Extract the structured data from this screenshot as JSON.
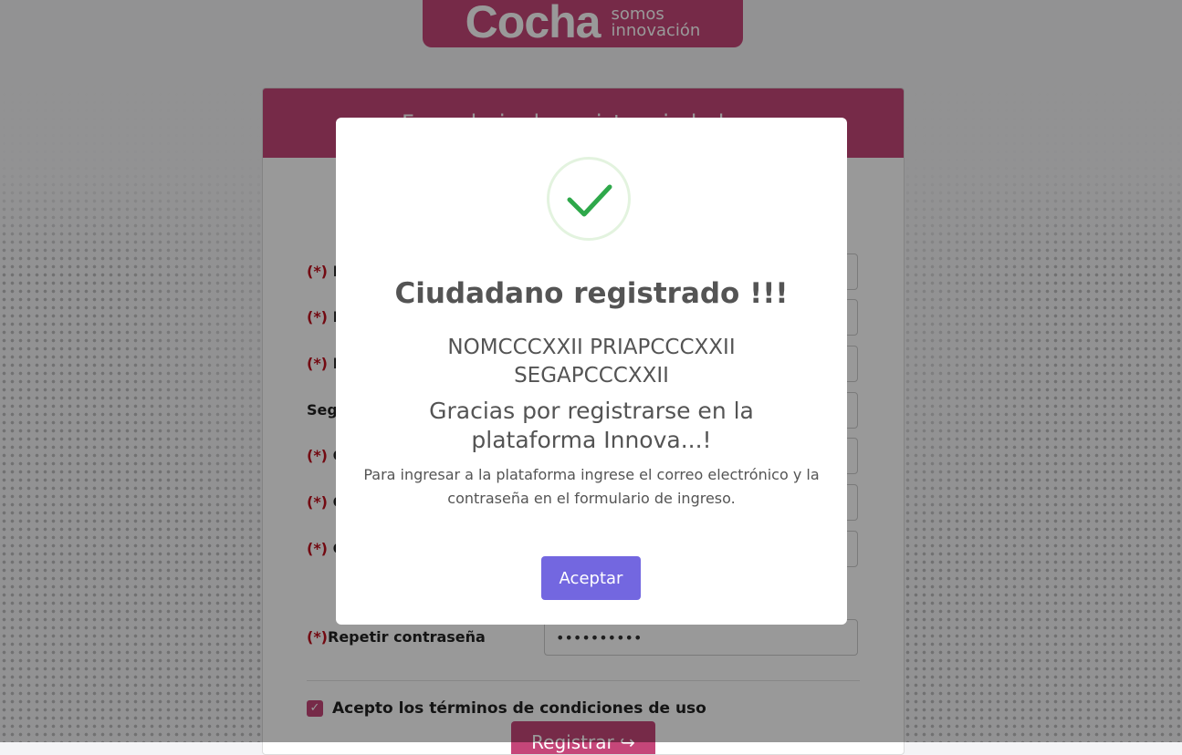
{
  "brand": {
    "logo_text": "Cocha",
    "tagline_line1": "somos",
    "tagline_line2": "innovación"
  },
  "form": {
    "header": "Formulario de registro ciudadano",
    "fields": [
      {
        "required": "(*)",
        "label": "N",
        "value": ""
      },
      {
        "required": "(*)",
        "label": "N",
        "value": ""
      },
      {
        "required": "(*)",
        "label": "N",
        "value": ""
      },
      {
        "required": "",
        "label": "Seg",
        "value": ""
      },
      {
        "required": "(*)",
        "label": "C",
        "value": ""
      },
      {
        "required": "(*)",
        "label": "C",
        "value": ""
      },
      {
        "required": "(*)",
        "label": "C",
        "value": ""
      },
      {
        "required": "(*)",
        "label": "Repetir contraseña",
        "value": "••••••••••"
      }
    ],
    "terms_label": "Acepto los términos de condiciones de uso",
    "terms_checked": true,
    "register_button": "Registrar"
  },
  "modal": {
    "title": "Ciudadano registrado !!!",
    "name": "NOMCCCXXII PRIAPCCCXXII SEGAPCCCXXII",
    "thanks": "Gracias por registrarse en la plataforma Innova...!",
    "info": "Para ingresar a la plataforma ingrese el correo electrónico y la contraseña en el formulario de ingreso.",
    "accept_button": "Aceptar",
    "icon": "check-icon"
  },
  "colors": {
    "brand": "#c54679",
    "accept_button": "#7367e0",
    "check": "#2ea84a",
    "required": "#c0121f"
  }
}
